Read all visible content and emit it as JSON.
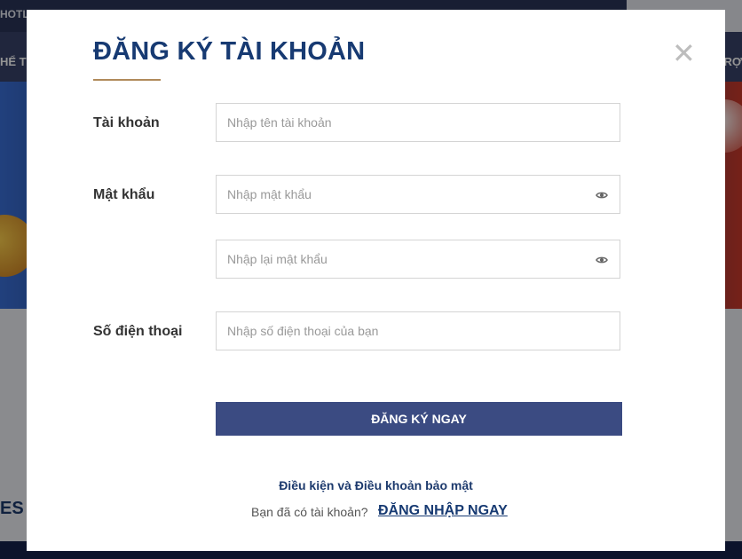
{
  "background": {
    "hotline_text": "HOTL",
    "nav_left_text": "HỂ T",
    "nav_right_text": "TRỢ",
    "section_text": "ES"
  },
  "modal": {
    "title": "ĐĂNG KÝ TÀI KHOẢN",
    "close_glyph": "✕",
    "fields": {
      "account_label": "Tài khoản",
      "account_placeholder": "Nhập tên tài khoản",
      "password_label": "Mật khẩu",
      "password_placeholder": "Nhập mật khẩu",
      "confirm_password_placeholder": "Nhập lại mật khẩu",
      "phone_label": "Số điện thoại",
      "phone_placeholder": "Nhập số điện thoại của bạn"
    },
    "submit_label": "ĐĂNG KÝ NGAY",
    "terms_link": "Điều kiện và Điều khoản bảo mật",
    "have_account_text": "Bạn đã có tài khoản?",
    "login_link": "ĐĂNG NHẬP NGAY"
  },
  "colors": {
    "title": "#173a72",
    "accent_underline": "#b08a5a",
    "button": "#3b4b82"
  },
  "icons": [
    "close-icon",
    "eye-icon"
  ]
}
